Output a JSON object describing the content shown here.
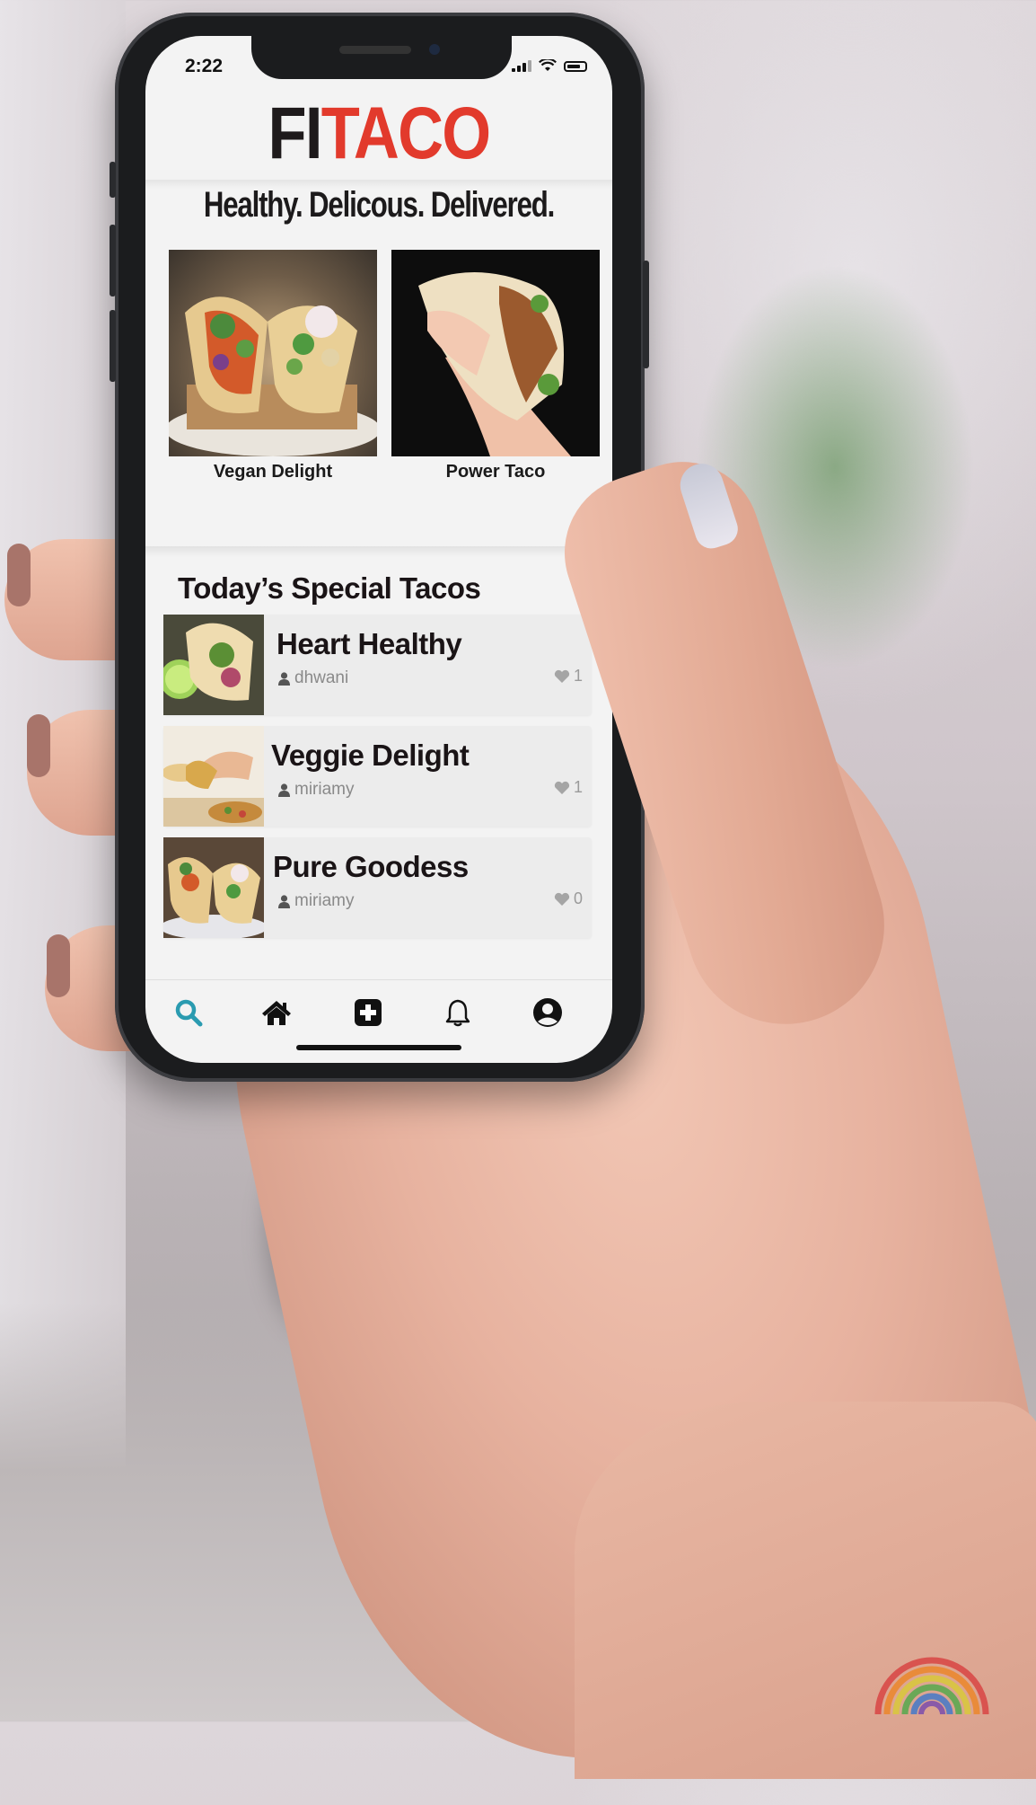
{
  "status_bar": {
    "time": "2:22"
  },
  "app": {
    "logo_part1": "FI",
    "logo_part2": "TACO",
    "tagline": "Healthy. Delicous. Delivered.",
    "colors": {
      "logo_dark": "#1e1a1b",
      "logo_accent": "#e23a2c",
      "active_tab": "#2a9bb0"
    }
  },
  "featured": [
    {
      "label": "Vegan Delight"
    },
    {
      "label": "Power Taco"
    }
  ],
  "specials": {
    "title": "Today’s Special Tacos",
    "items": [
      {
        "title": "Heart Healthy",
        "user": "dhwani",
        "likes": "1"
      },
      {
        "title": "Veggie Delight",
        "user": "miriamy",
        "likes": "1"
      },
      {
        "title": "Pure Goodess",
        "user": "miriamy",
        "likes": "0"
      }
    ]
  },
  "tabbar": {
    "tabs": [
      {
        "icon": "search-icon",
        "active": true
      },
      {
        "icon": "home-icon",
        "active": false
      },
      {
        "icon": "add-icon",
        "active": false
      },
      {
        "icon": "bell-icon",
        "active": false
      },
      {
        "icon": "profile-icon",
        "active": false
      }
    ]
  }
}
